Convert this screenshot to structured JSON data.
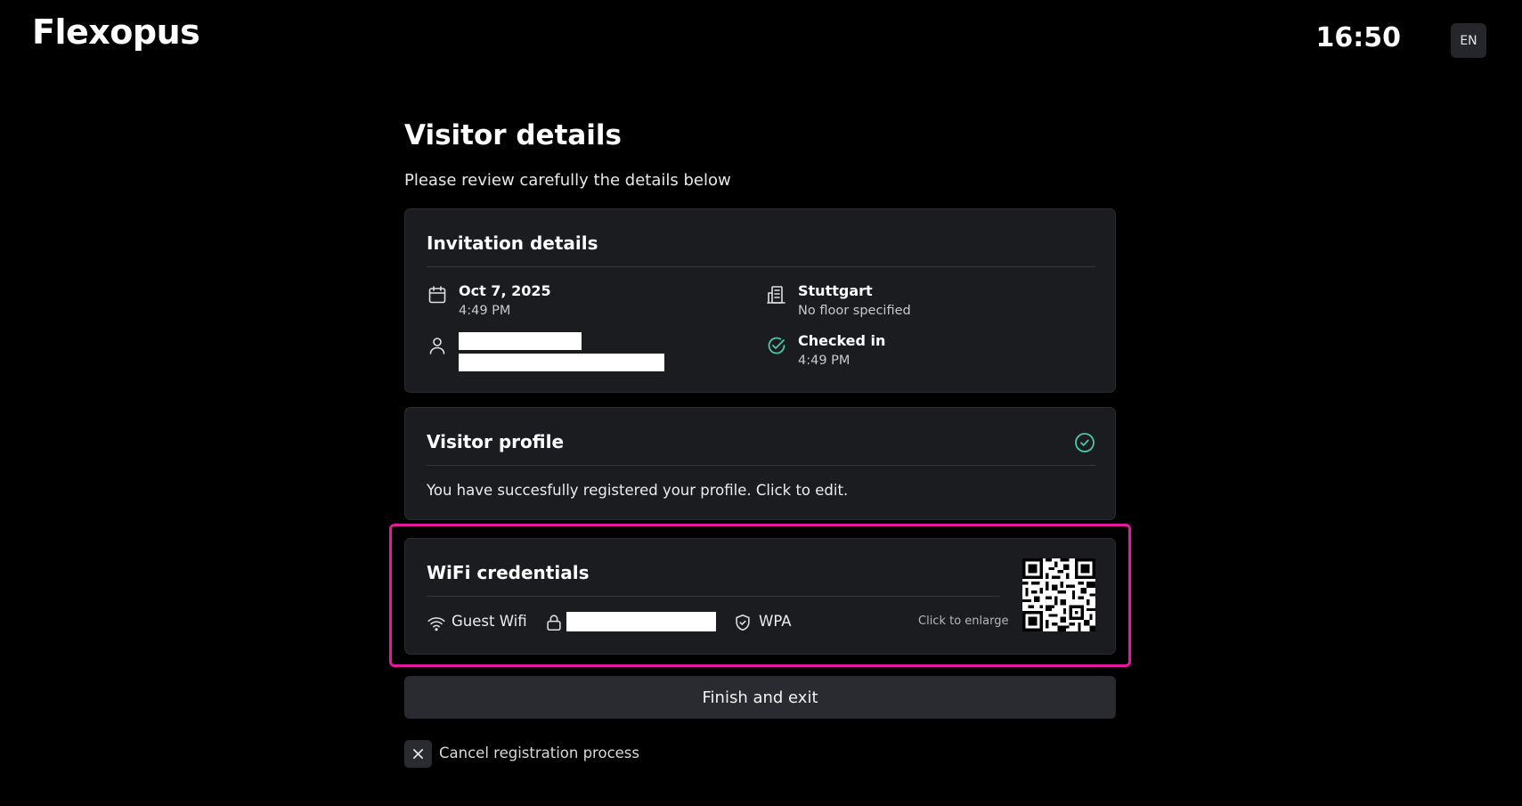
{
  "theme": {
    "background": "#000000",
    "accent_teal": "#4fc6a7",
    "highlight": "#e6199e",
    "card": "#1b1c20"
  },
  "header": {
    "brand": "Flexopus",
    "time": "16:50",
    "language": "EN"
  },
  "page": {
    "title": "Visitor details",
    "subtitle": "Please review carefully the details below"
  },
  "invitation": {
    "title": "Invitation details",
    "date": "Oct 7, 2025",
    "time": "4:49 PM",
    "location": "Stuttgart",
    "floor": "No floor specified",
    "status": "Checked in",
    "status_time": "4:49 PM",
    "icons": [
      "calendar-icon",
      "user-icon",
      "building-icon",
      "check-circle-icon"
    ]
  },
  "profile": {
    "title": "Visitor profile",
    "message": "You have succesfully registered your profile. Click to edit.",
    "icon": "check-circle-icon"
  },
  "wifi": {
    "title": "WiFi credentials",
    "network": "Guest Wifi",
    "security": "WPA",
    "enlarge_hint": "Click to enlarge",
    "icons": [
      "wifi-icon",
      "lock-icon",
      "shield-icon",
      "qr-code-icon"
    ]
  },
  "actions": {
    "finish": "Finish and exit",
    "cancel": "Cancel registration process"
  }
}
